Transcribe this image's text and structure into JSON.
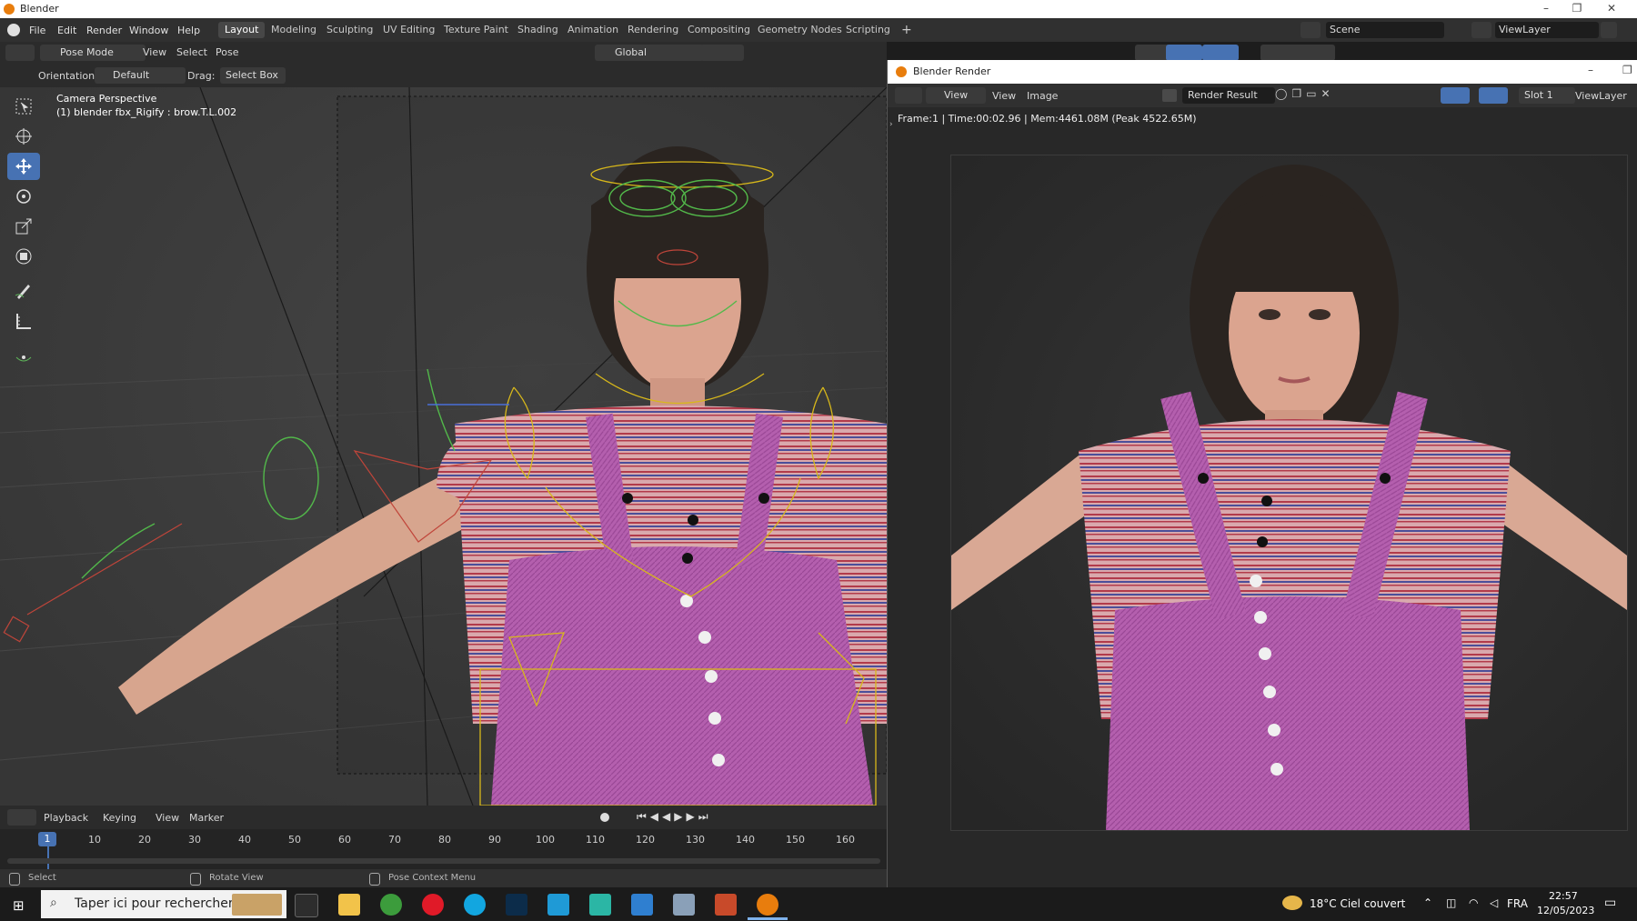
{
  "window": {
    "title": "Blender",
    "minimize": "–",
    "restore": "❐",
    "close": "✕"
  },
  "menu": [
    "File",
    "Edit",
    "Render",
    "Window",
    "Help"
  ],
  "workspaces": [
    "Layout",
    "Modeling",
    "Sculpting",
    "UV Editing",
    "Texture Paint",
    "Shading",
    "Animation",
    "Rendering",
    "Compositing",
    "Geometry Nodes",
    "Scripting"
  ],
  "add_workspace": "+",
  "scene": {
    "scene_name": "Scene",
    "view_layer": "ViewLayer"
  },
  "viewport_header": {
    "mode": "Pose Mode",
    "menus": [
      "View",
      "Select",
      "Pose"
    ],
    "transform_orientation": "Global",
    "orientation_label": "Orientation:",
    "orientation_value": "Default",
    "drag_label": "Drag:",
    "drag_value": "Select Box"
  },
  "viewport": {
    "overlay_title": "Camera Perspective",
    "overlay_object": "(1) blender fbx_Rigify : brow.T.L.002"
  },
  "tools": [
    "select-box-icon",
    "cursor-icon",
    "move-icon",
    "rotate-icon",
    "scale-icon",
    "transform-icon",
    "annotate-icon",
    "measure-icon",
    "bone-roll-icon"
  ],
  "timeline": {
    "menus": [
      "Playback",
      "Keying",
      "View",
      "Marker"
    ],
    "current_frame": "1",
    "frame_labels": [
      "10",
      "20",
      "30",
      "40",
      "50",
      "60",
      "70",
      "80",
      "90",
      "100",
      "110",
      "120",
      "130",
      "140",
      "150",
      "160"
    ]
  },
  "statusbar": {
    "left": "Select",
    "middle": "Rotate View",
    "right": "Pose Context Menu"
  },
  "render_window": {
    "title": "Blender Render",
    "menus": [
      "View",
      "View",
      "Image"
    ],
    "image_name": "Render Result",
    "slot": "Slot 1",
    "view_layer": "ViewLayer",
    "info": "Frame:1 | Time:00:02.96 | Mem:4461.08M (Peak 4522.65M)"
  },
  "taskbar": {
    "search_placeholder": "Taper ici pour rechercher",
    "weather": "18°C  Ciel couvert",
    "language": "FRA",
    "time": "22:57",
    "date": "12/05/2023"
  },
  "colors": {
    "accent": "#4772b3",
    "bone_yellow": "#d8b81a",
    "bone_green": "#52b84a",
    "shirt_red": "#b8384a",
    "overalls": "#b05aa8"
  }
}
